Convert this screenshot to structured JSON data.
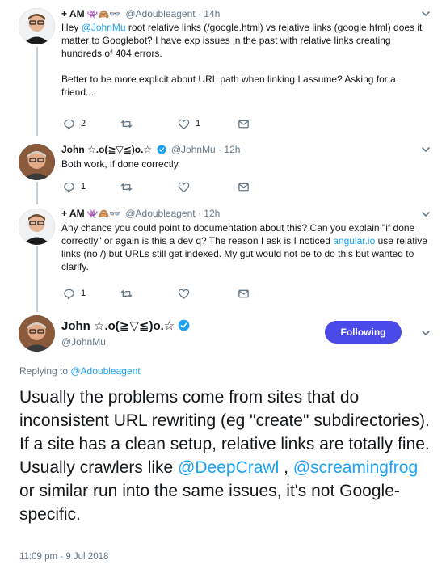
{
  "tweets": [
    {
      "name": "+ AM",
      "emoji": "👾🙈👓",
      "handle": "@Adoubleagent",
      "sep": "·",
      "time": "14h",
      "text_pre": "Hey ",
      "mention": "@JohnMu",
      "text_post": " root relative links (/google.html) vs relative links (google.html) does it matter to Googlebot? I have exp issues in the past with relative links creating hundreds of 404 errors.",
      "text2": "Better to be more explicit about URL path when linking I assume? Asking for a friend...",
      "reply_count": "2",
      "retweet_count": "",
      "like_count": "1"
    },
    {
      "name": "John ☆.o(≧▽≦)o.☆",
      "handle": "@JohnMu",
      "sep": "·",
      "time": "12h",
      "text": "Both work, if done correctly.",
      "reply_count": "1",
      "retweet_count": "",
      "like_count": ""
    },
    {
      "name": "+ AM",
      "emoji": "👾🙈👓",
      "handle": "@Adoubleagent",
      "sep": "·",
      "time": "12h",
      "text_pre": "Any chance you could point to documentation about this? Can you explain \"if done correctly\" or again is this a dev q? The reason I ask is I noticed ",
      "link": "angular.io",
      "text_post": " use relative links (no /) but URLs still get indexed. My gut would not be to do this but wanted to clarify.",
      "reply_count": "1",
      "retweet_count": "",
      "like_count": ""
    }
  ],
  "main": {
    "name": "John ☆.o(≧▽≦)o.☆",
    "handle": "@JohnMu",
    "follow_label": "Following",
    "replying_prefix": "Replying to ",
    "replying_to": "@Adoubleagent",
    "text_1": "Usually the problems come from sites that do inconsistent URL rewriting (eg \"create\" subdirectories). If a site has a clean setup, relative links are totally fine. Usually crawlers like ",
    "mention_1": "@DeepCrawl",
    "text_2": " , ",
    "mention_2": "@screamingfrog",
    "text_3": " or similar run into the same issues, it's not Google-specific.",
    "timestamp": "11:09 pm - 9 Jul 2018"
  },
  "colors": {
    "accent": "#1da1f2",
    "follow_button": "#4a4ae8",
    "muted": "#657786",
    "thread_line": "#c4cfd6"
  },
  "icons": [
    "reply-icon",
    "retweet-icon",
    "like-icon",
    "message-icon",
    "chevron-down-icon",
    "verified-icon"
  ]
}
